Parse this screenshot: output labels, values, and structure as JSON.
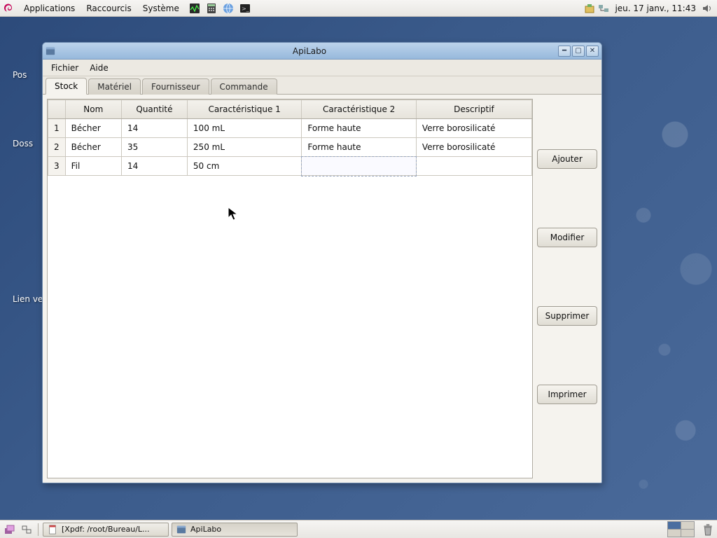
{
  "top_panel": {
    "menus": [
      "Applications",
      "Raccourcis",
      "Système"
    ],
    "clock": "jeu. 17 janv., 11:43"
  },
  "desktop_labels": {
    "pos": "Pos",
    "doss": "Doss",
    "lien": "Lien ve"
  },
  "window": {
    "title": "ApiLabo",
    "menubar": {
      "file": "Fichier",
      "help": "Aide"
    },
    "tabs": [
      "Stock",
      "Matériel",
      "Fournisseur",
      "Commande"
    ],
    "headers": {
      "num": "",
      "nom": "Nom",
      "quantite": "Quantité",
      "carac1": "Caractéristique 1",
      "carac2": "Caractéristique 2",
      "descriptif": "Descriptif"
    },
    "rows": [
      {
        "n": "1",
        "nom": "Bécher",
        "quantite": "14",
        "carac1": "100 mL",
        "carac2": "Forme haute",
        "descriptif": "Verre borosilicaté"
      },
      {
        "n": "2",
        "nom": "Bécher",
        "quantite": "35",
        "carac1": "250 mL",
        "carac2": "Forme haute",
        "descriptif": "Verre borosilicaté"
      },
      {
        "n": "3",
        "nom": "Fil",
        "quantite": "14",
        "carac1": "50 cm",
        "carac2": "",
        "descriptif": ""
      }
    ],
    "buttons": {
      "ajouter": "Ajouter",
      "modifier": "Modifier",
      "supprimer": "Supprimer",
      "imprimer": "Imprimer"
    }
  },
  "taskbar": {
    "items": [
      {
        "label": "[Xpdf: /root/Bureau/L..."
      },
      {
        "label": "ApiLabo"
      }
    ]
  }
}
